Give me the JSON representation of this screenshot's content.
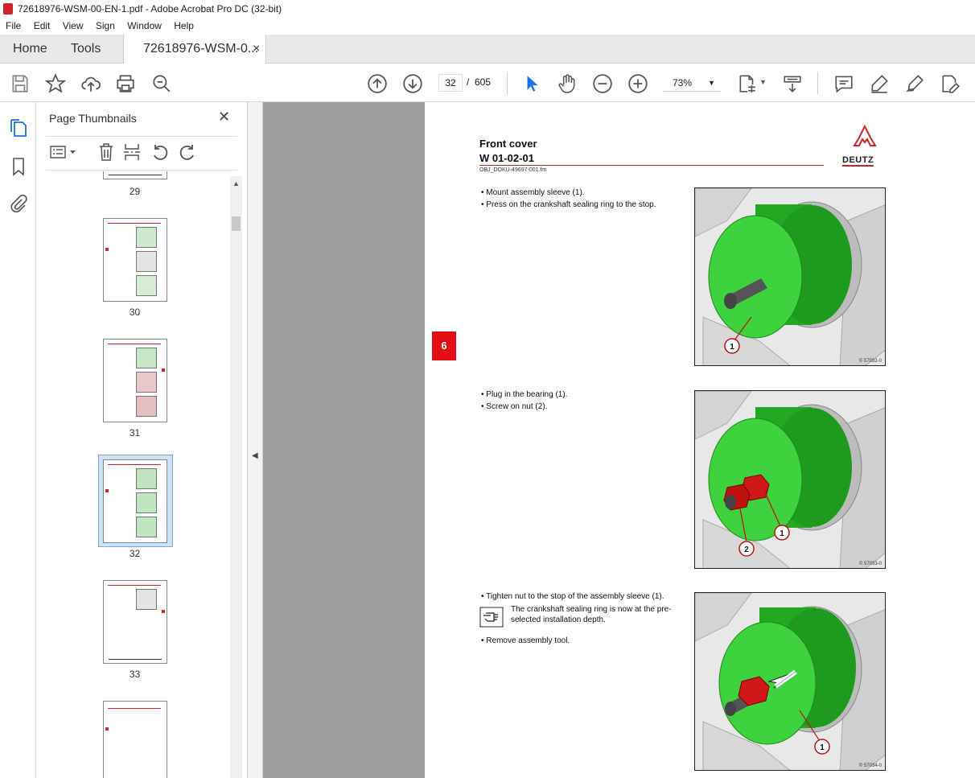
{
  "window": {
    "title": "72618976-WSM-00-EN-1.pdf - Adobe Acrobat Pro DC (32-bit)"
  },
  "menu": [
    "File",
    "Edit",
    "View",
    "Sign",
    "Window",
    "Help"
  ],
  "tabs": {
    "home": "Home",
    "tools": "Tools",
    "doc": "72618976-WSM-0...",
    "close": "×"
  },
  "nav": {
    "current_page": "32",
    "separator": "/",
    "total_pages": "605",
    "zoom": "73%"
  },
  "panel": {
    "title": "Page Thumbnails",
    "close": "✕",
    "thumbs": [
      "29",
      "30",
      "31",
      "32",
      "33"
    ]
  },
  "doc": {
    "title": "Front cover",
    "code": "W 01-02-01",
    "file": "OBJ_DOKU-49697-001.fm",
    "logo": "DEUTZ",
    "chapter": "6",
    "step1": [
      "Mount assembly sleeve (1).",
      "Press on the crankshaft sealing ring to the stop."
    ],
    "step2": [
      "Plug in the bearing (1).",
      "Screw on nut (2)."
    ],
    "step3": [
      "Tighten nut to the stop of the assembly sleeve (1)."
    ],
    "note": "The crankshaft sealing ring is now at the pre-selected installation depth.",
    "step4": [
      "Remove assembly tool."
    ],
    "fig1": {
      "num": "© 57032-0",
      "callouts": [
        "1"
      ]
    },
    "fig2": {
      "num": "© 57033-0",
      "callouts": [
        "1",
        "2"
      ]
    },
    "fig3": {
      "num": "© 57034-0",
      "callouts": [
        "1"
      ]
    }
  },
  "colors": {
    "brand_red": "#d2232a",
    "tool_green": "#3cc83c",
    "nut_red": "#d01818"
  }
}
